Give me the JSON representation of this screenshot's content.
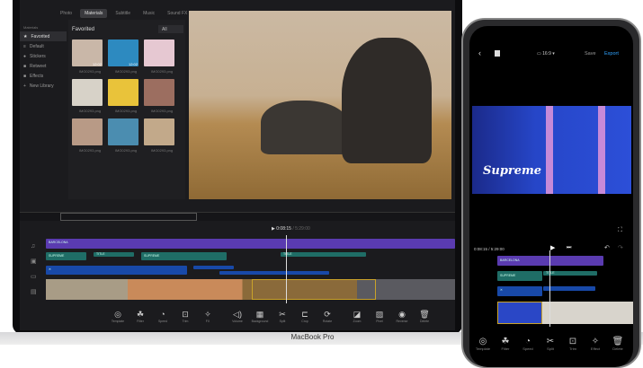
{
  "laptop": {
    "tabs": [
      "Photo",
      "Materials",
      "Subtitle",
      "Music",
      "Sound FX"
    ],
    "active_tab": "Materials",
    "sidebar": {
      "heading": "Materials",
      "items": [
        {
          "label": "Favorited",
          "icon": "star-icon"
        },
        {
          "label": "Default",
          "icon": "layers-icon"
        },
        {
          "label": "Stickers",
          "icon": "sticker-icon"
        },
        {
          "label": "Retweet",
          "icon": "folder-icon"
        },
        {
          "label": "Effects",
          "icon": "folder-icon"
        },
        {
          "label": "New Library",
          "icon": "plus-icon"
        }
      ]
    },
    "media": {
      "title": "Favorited",
      "filter": "All",
      "items": [
        {
          "name": "IMG0293.png",
          "duration": "12:02",
          "color": "#c9b7a8"
        },
        {
          "name": "IMG0293.png",
          "duration": "12:02",
          "color": "#2d8ac0"
        },
        {
          "name": "IMG0293.png",
          "color": "#e6c8d2"
        },
        {
          "name": "IMG0293.png",
          "color": "#d7d2c8"
        },
        {
          "name": "IMG0293.png",
          "color": "#e9c33a"
        },
        {
          "name": "IMG0293.png",
          "color": "#9c6e60"
        },
        {
          "name": "IMG0293.png",
          "color": "#b89a86"
        },
        {
          "name": "IMG0293.png",
          "color": "#4b8db0"
        },
        {
          "name": "IMG0293.png",
          "color": "#c2a98a"
        }
      ]
    },
    "timecode": "0:08:15",
    "duration": "5:29:00",
    "tracks": {
      "music": "BARCELONA",
      "title1": "SUPREME",
      "title2": "SUPREME",
      "title_small": "TITLE"
    },
    "toolbar": [
      "Template",
      "Filter",
      "Speed",
      "Trim",
      "FX",
      "Volume",
      "Background",
      "Split",
      "Crop",
      "Rotate",
      "Zoom",
      "Pixel",
      "Reverse",
      "Delete"
    ],
    "brand": "MacBook Pro"
  },
  "phone": {
    "aspect": "16:9",
    "save": "Save",
    "export": "Export",
    "overlay_text": "Supreme",
    "timecode": "0:08:15 / 5:29:00",
    "tracks": {
      "music": "BARCELONA",
      "title": "SUPREME",
      "title_small": "TITLE"
    },
    "toolbar": [
      "Template",
      "Filter",
      "Speed",
      "Split",
      "Trim",
      "Effect",
      "Delete"
    ],
    "accent": "#2fa3ff"
  }
}
